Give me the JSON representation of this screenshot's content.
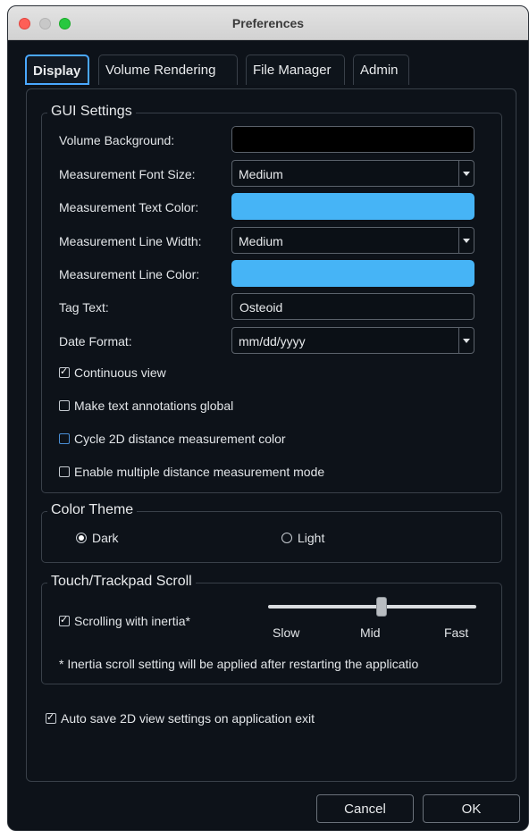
{
  "window": {
    "title": "Preferences"
  },
  "tabs": [
    {
      "label": "Display",
      "active": true
    },
    {
      "label": "Volume Rendering",
      "active": false
    },
    {
      "label": "File Manager",
      "active": false
    },
    {
      "label": "Admin",
      "active": false
    }
  ],
  "gui_settings": {
    "legend": "GUI Settings",
    "volume_background": {
      "label": "Volume Background:",
      "color": "#000000"
    },
    "font_size": {
      "label": "Measurement Font Size:",
      "value": "Medium"
    },
    "text_color": {
      "label": "Measurement Text Color:",
      "color": "#46b4f6"
    },
    "line_width": {
      "label": "Measurement Line Width:",
      "value": "Medium"
    },
    "line_color": {
      "label": "Measurement Line Color:",
      "color": "#46b4f6"
    },
    "tag_text": {
      "label": "Tag Text:",
      "value": "Osteoid"
    },
    "date_format": {
      "label": "Date Format:",
      "value": "mm/dd/yyyy"
    },
    "checkboxes": [
      {
        "label": "Continuous view",
        "checked": true
      },
      {
        "label": "Make text annotations global",
        "checked": false
      },
      {
        "label": "Cycle 2D distance measurement color",
        "checked": false
      },
      {
        "label": "Enable multiple distance measurement mode",
        "checked": false
      }
    ]
  },
  "color_theme": {
    "legend": "Color Theme",
    "options": [
      {
        "label": "Dark",
        "selected": true
      },
      {
        "label": "Light",
        "selected": false
      }
    ]
  },
  "scroll": {
    "legend": "Touch/Trackpad Scroll",
    "inertia_label": "Scrolling with inertia*",
    "inertia_checked": true,
    "slider_labels": {
      "slow": "Slow",
      "mid": "Mid",
      "fast": "Fast"
    },
    "slider_value": "Mid",
    "note": "* Inertia scroll setting will be applied after restarting the applicatio"
  },
  "auto_save": {
    "label": "Auto save 2D view settings on application exit",
    "checked": true
  },
  "buttons": {
    "cancel": "Cancel",
    "ok": "OK"
  },
  "colors": {
    "accent": "#46b4f6",
    "background": "#0d1219",
    "tab_focus": "#4aa8ff"
  }
}
